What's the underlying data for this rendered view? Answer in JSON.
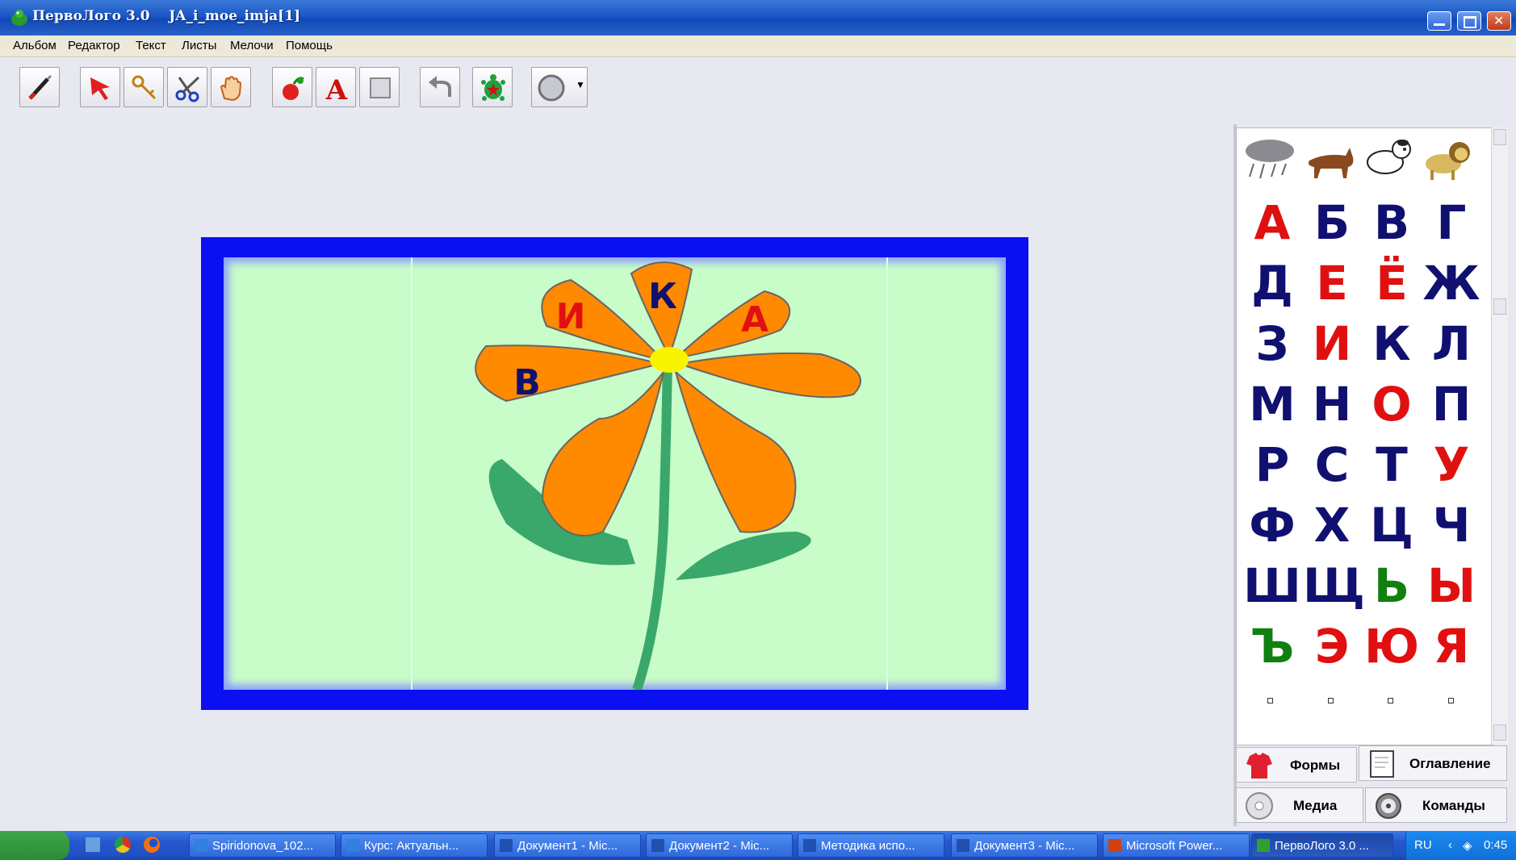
{
  "window": {
    "app_name": "ПервоЛого 3.0",
    "document": "JA_i_moe_imja[1]"
  },
  "menu": [
    "Альбом",
    "Редактор",
    "Текст",
    "Листы",
    "Мелочи",
    "Помощь"
  ],
  "toolbar": [
    "brush-tool",
    "pointer-tool",
    "key-tool",
    "scissors-tool",
    "hand-tool",
    "new-character-tool",
    "text-tool",
    "shape-tool",
    "undo",
    "turtle",
    "shape-selector"
  ],
  "flower_letters": {
    "top": "К",
    "left": "И",
    "right": "А",
    "far_left": "В"
  },
  "alphabet": [
    {
      "ch": "А",
      "c": "#e01010"
    },
    {
      "ch": "Б",
      "c": "#101070"
    },
    {
      "ch": "В",
      "c": "#101070"
    },
    {
      "ch": "Г",
      "c": "#101070"
    },
    {
      "ch": "Д",
      "c": "#101070"
    },
    {
      "ch": "Е",
      "c": "#e01010"
    },
    {
      "ch": "Ё",
      "c": "#e01010"
    },
    {
      "ch": "Ж",
      "c": "#101070"
    },
    {
      "ch": "З",
      "c": "#101070"
    },
    {
      "ch": "И",
      "c": "#e01010"
    },
    {
      "ch": "К",
      "c": "#101070"
    },
    {
      "ch": "Л",
      "c": "#101070"
    },
    {
      "ch": "М",
      "c": "#101070"
    },
    {
      "ch": "Н",
      "c": "#101070"
    },
    {
      "ch": "О",
      "c": "#e01010"
    },
    {
      "ch": "П",
      "c": "#101070"
    },
    {
      "ch": "Р",
      "c": "#101070"
    },
    {
      "ch": "С",
      "c": "#101070"
    },
    {
      "ch": "Т",
      "c": "#101070"
    },
    {
      "ch": "У",
      "c": "#e01010"
    },
    {
      "ch": "Ф",
      "c": "#101070"
    },
    {
      "ch": "Х",
      "c": "#101070"
    },
    {
      "ch": "Ц",
      "c": "#101070"
    },
    {
      "ch": "Ч",
      "c": "#101070"
    },
    {
      "ch": "Ш",
      "c": "#101070"
    },
    {
      "ch": "Щ",
      "c": "#101070"
    },
    {
      "ch": "Ь",
      "c": "#108010"
    },
    {
      "ch": "Ы",
      "c": "#e01010"
    },
    {
      "ch": "Ъ",
      "c": "#108010"
    },
    {
      "ch": "Э",
      "c": "#e01010"
    },
    {
      "ch": "Ю",
      "c": "#e01010"
    },
    {
      "ch": "Я",
      "c": "#e01010"
    }
  ],
  "panel_tabs": {
    "forms": "Формы",
    "contents": "Оглавление",
    "media": "Медиа",
    "commands": "Команды"
  },
  "taskbar": {
    "items": [
      "Spiridonova_102...",
      "Курс: Актуальн...",
      "Документ1 - Mic...",
      "Документ2 - Mic...",
      "Методика испо...",
      "Документ3 - Mic...",
      "Microsoft Power...",
      "ПервоЛого 3.0 ..."
    ],
    "lang": "RU",
    "time": "0:45"
  }
}
